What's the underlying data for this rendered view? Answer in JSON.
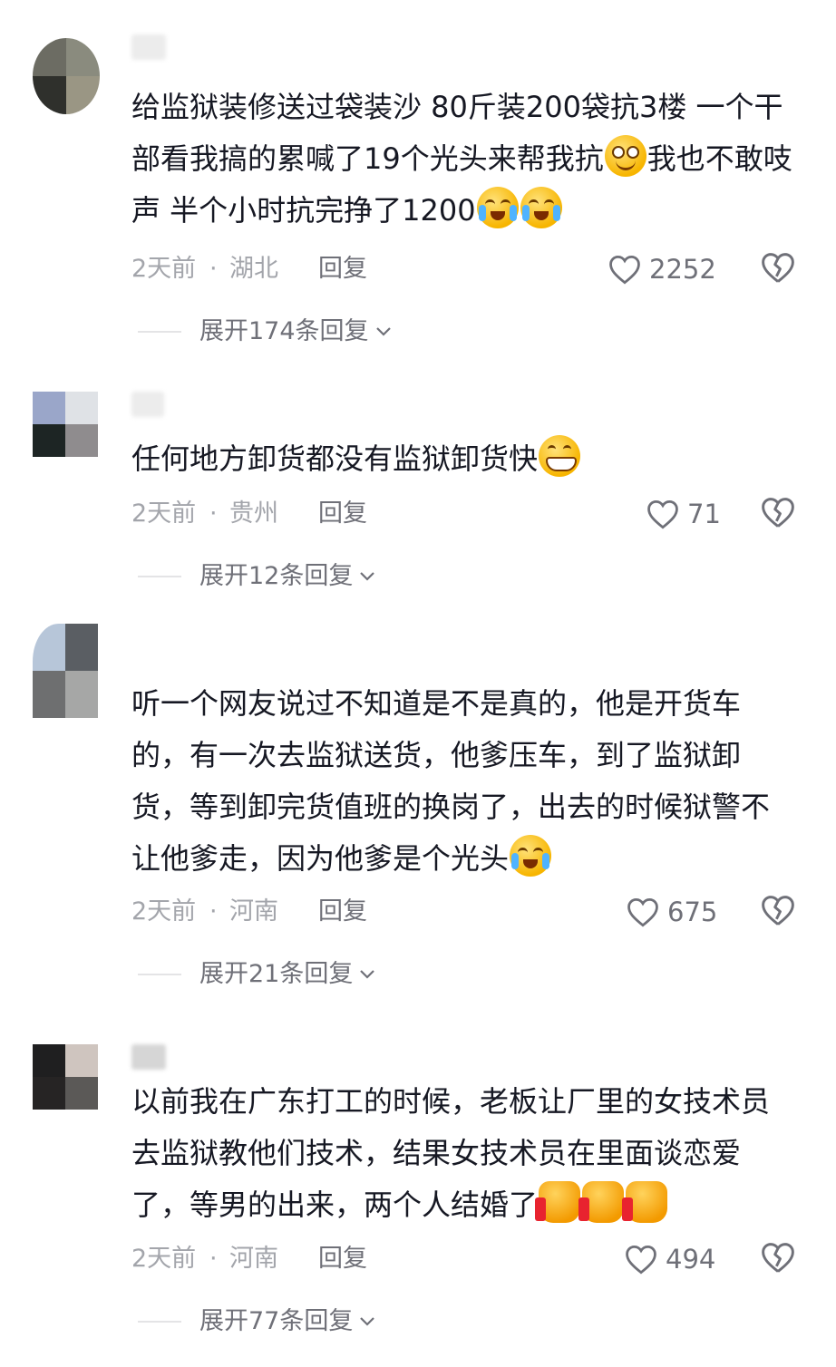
{
  "comments": [
    {
      "text_parts": [
        "给监狱装修送过袋装沙  80斤装200袋抗3楼  一个干部看我搞的累喊了19个光头来帮我抗",
        "我也不敢吱声  半个小时抗完挣了1200",
        ""
      ],
      "emojis": [
        "smile-emoji",
        "crying-laughing-emoji",
        "crying-laughing-emoji"
      ],
      "time": "2天前",
      "separator": "·",
      "location": "湖北",
      "reply_label": "回复",
      "likes": "2252",
      "expand_label": "展开174条回复"
    },
    {
      "text_parts": [
        "任何地方卸货都没有监狱卸货快"
      ],
      "emojis": [
        "grin-emoji"
      ],
      "time": "2天前",
      "separator": "·",
      "location": "贵州",
      "reply_label": "回复",
      "likes": "71",
      "expand_label": "展开12条回复"
    },
    {
      "text_parts": [
        "听一个网友说过不知道是不是真的，他是开货车的，有一次去监狱送货，他爹压车，到了监狱卸货，等到卸完货值班的换岗了，出去的时候狱警不让他爹走，因为他爹是个光头"
      ],
      "emojis": [
        "rolling-laugh-emoji"
      ],
      "time": "2天前",
      "separator": "·",
      "location": "河南",
      "reply_label": "回复",
      "likes": "675",
      "expand_label": "展开21条回复"
    },
    {
      "text_parts": [
        "以前我在广东打工的时候，老板让厂里的女技术员去监狱教他们技术，结果女技术员在里面谈恋爱了，等男的出来，两个人结婚了"
      ],
      "emojis": [
        "thumbs-up-emoji",
        "thumbs-up-emoji",
        "thumbs-up-emoji"
      ],
      "time": "2天前",
      "separator": "·",
      "location": "河南",
      "reply_label": "回复",
      "likes": "494",
      "expand_label": "展开77条回复"
    }
  ],
  "colors": {
    "text": "#161823",
    "meta": "#a3a5ab",
    "secondary": "#6f7078",
    "background": "#ffffff"
  }
}
